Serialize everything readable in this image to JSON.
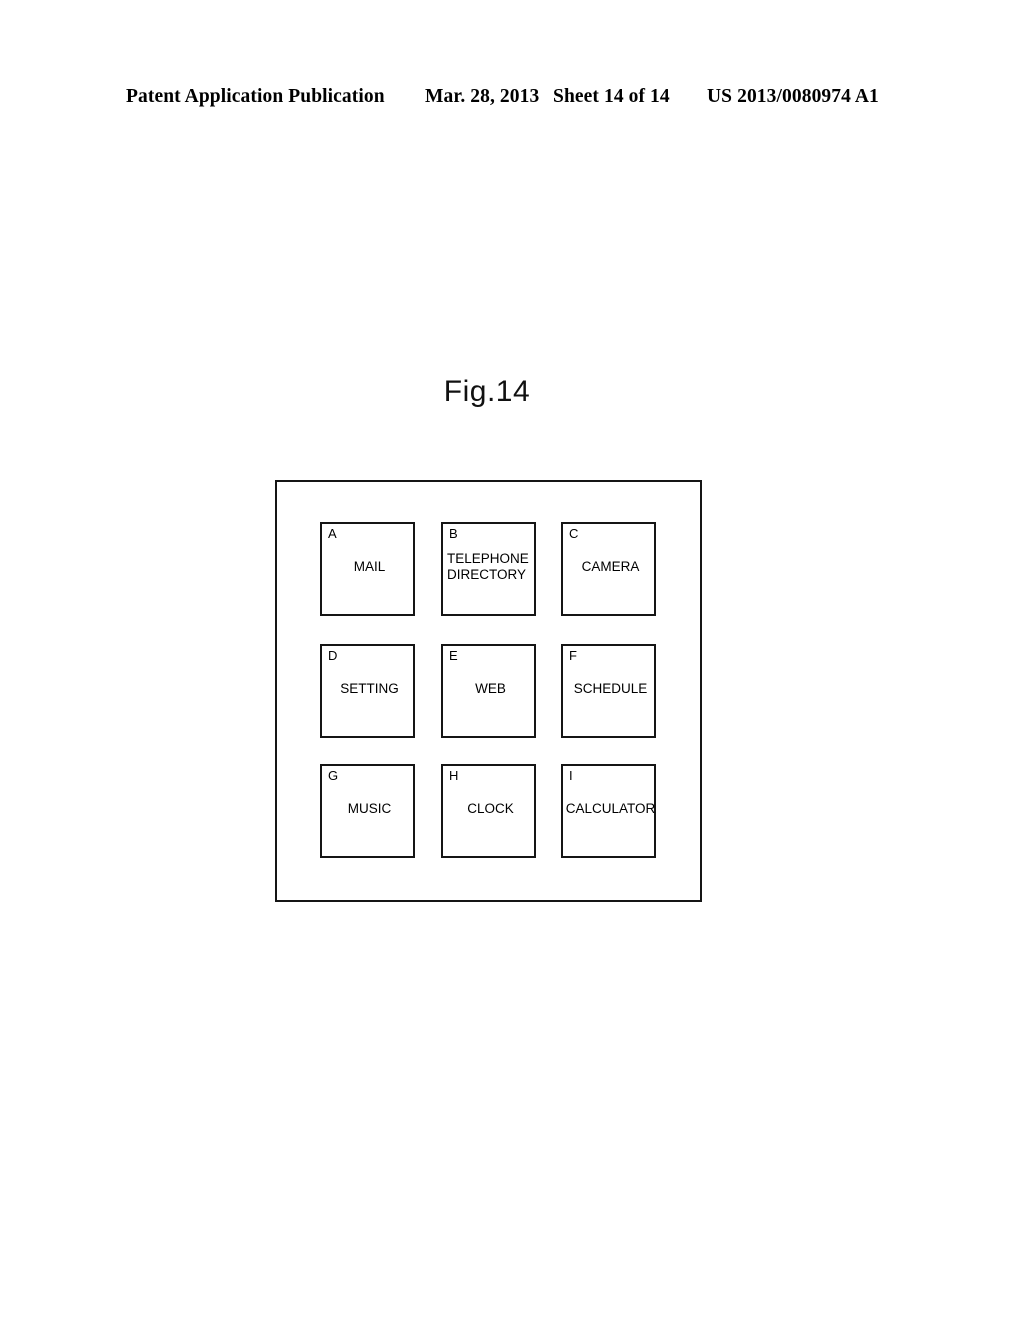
{
  "header": {
    "publication": "Patent Application Publication",
    "date": "Mar. 28, 2013",
    "sheet": "Sheet 14 of 14",
    "number": "US 2013/0080974 A1"
  },
  "figure": {
    "title": "Fig.14"
  },
  "screen": {
    "grid": {
      "rows": 3,
      "columns": 3,
      "cells": [
        {
          "key": "A",
          "label": "MAIL"
        },
        {
          "key": "B",
          "label": "TELEPHONE DIRECTORY"
        },
        {
          "key": "C",
          "label": "CAMERA"
        },
        {
          "key": "D",
          "label": "SETTING"
        },
        {
          "key": "E",
          "label": "WEB"
        },
        {
          "key": "F",
          "label": "SCHEDULE"
        },
        {
          "key": "G",
          "label": "MUSIC"
        },
        {
          "key": "H",
          "label": "CLOCK"
        },
        {
          "key": "I",
          "label": "CALCULATOR"
        }
      ]
    }
  },
  "colors": {
    "ink": "#151515",
    "page": "#ffffff"
  }
}
